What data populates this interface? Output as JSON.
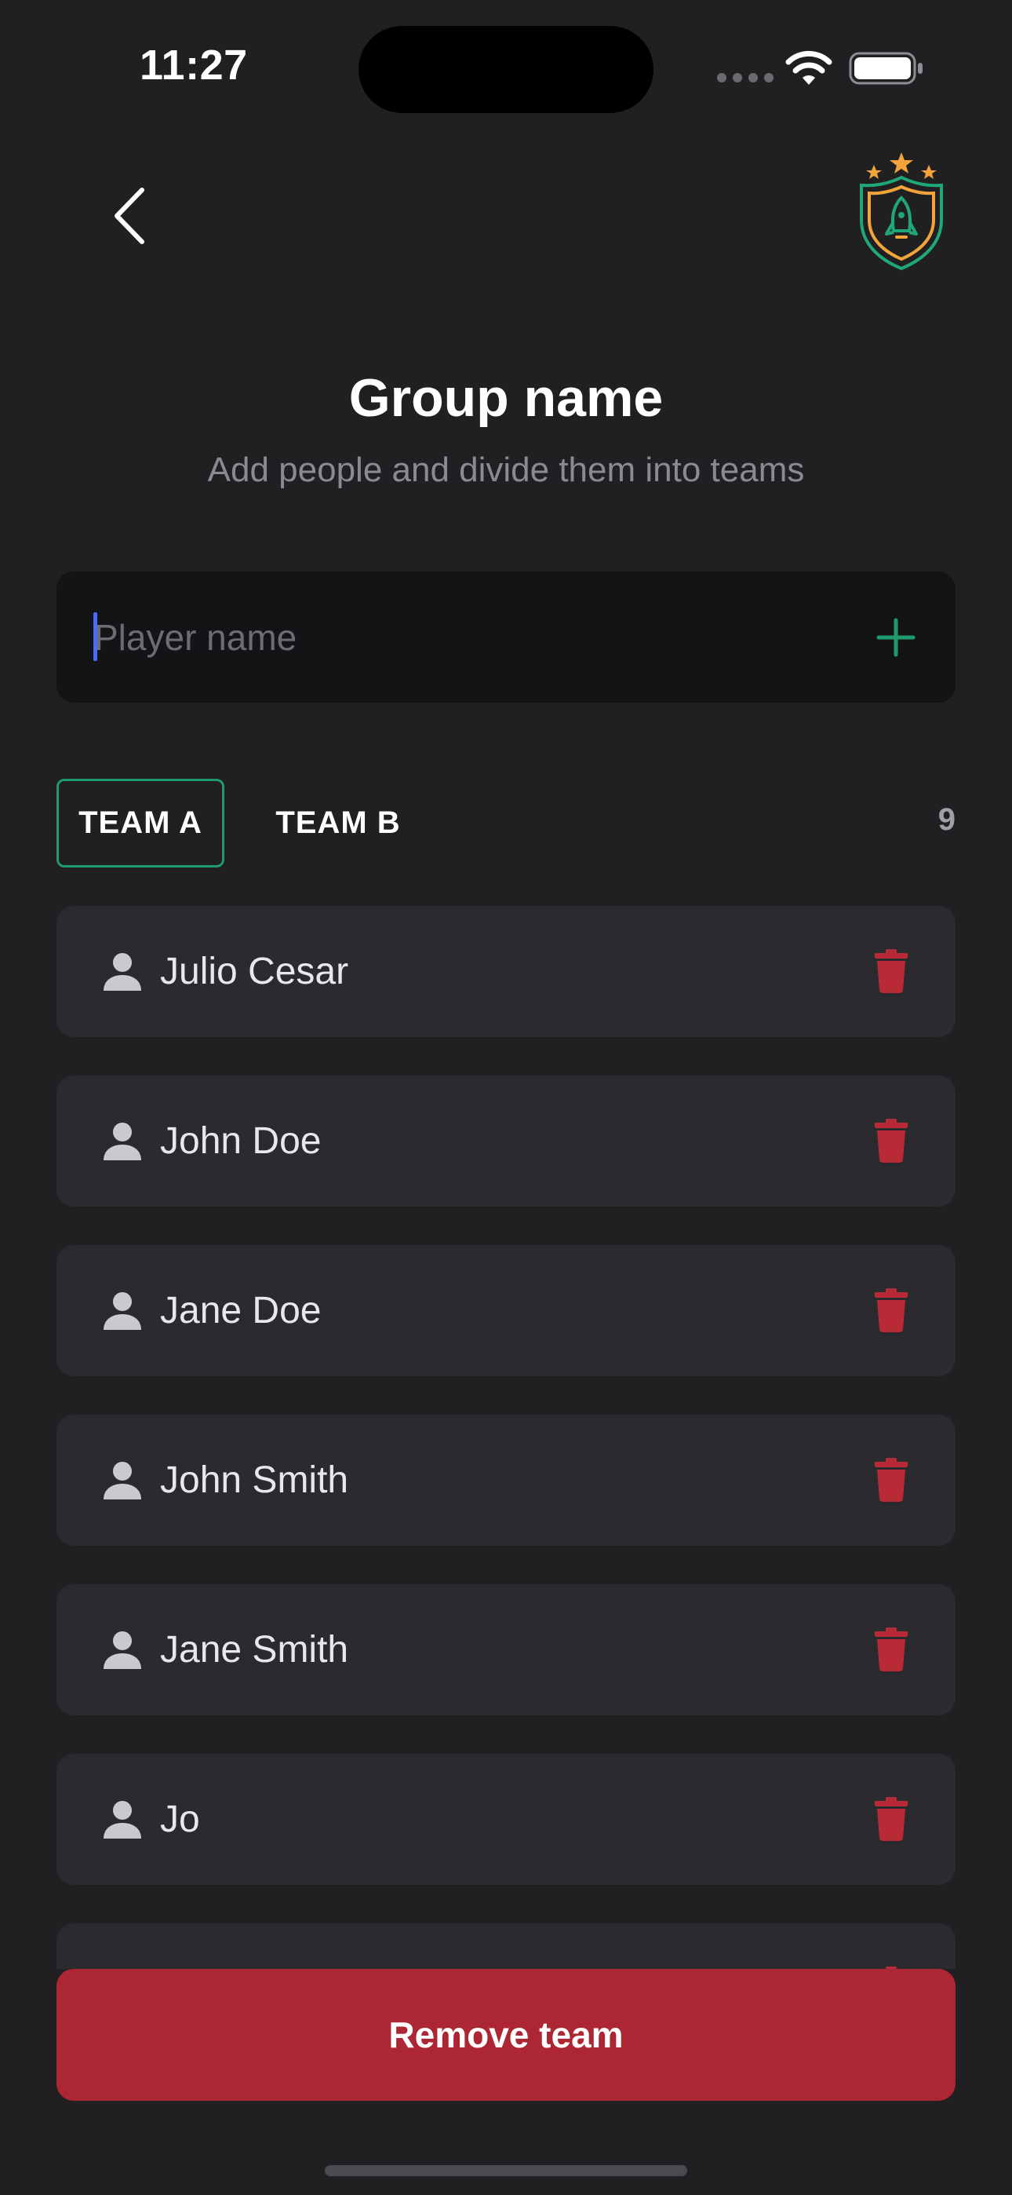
{
  "status_bar": {
    "time": "11:27"
  },
  "header": {
    "back_icon": "chevron-left-icon",
    "logo_icon": "rocket-shield-badge-icon",
    "title": "Group name",
    "subtitle": "Add people and divide them into teams"
  },
  "player_input": {
    "value": "",
    "placeholder": "Player name",
    "add_icon": "plus-icon"
  },
  "tabs": [
    {
      "label": "TEAM A",
      "active": true
    },
    {
      "label": "TEAM B",
      "active": false
    }
  ],
  "player_count": "9",
  "players": [
    {
      "name": "Julio Cesar"
    },
    {
      "name": "John Doe"
    },
    {
      "name": "Jane Doe"
    },
    {
      "name": "John Smith"
    },
    {
      "name": "Jane Smith"
    },
    {
      "name": "Jo"
    },
    {
      "name": ""
    }
  ],
  "row_icons": {
    "person": "person-icon",
    "delete": "trash-icon"
  },
  "remove_button": {
    "label": "Remove team"
  },
  "colors": {
    "background": "#202023",
    "accent_green": "#1f9a6c",
    "danger_red": "#ad2633",
    "logo_orange": "#f2a33a"
  }
}
